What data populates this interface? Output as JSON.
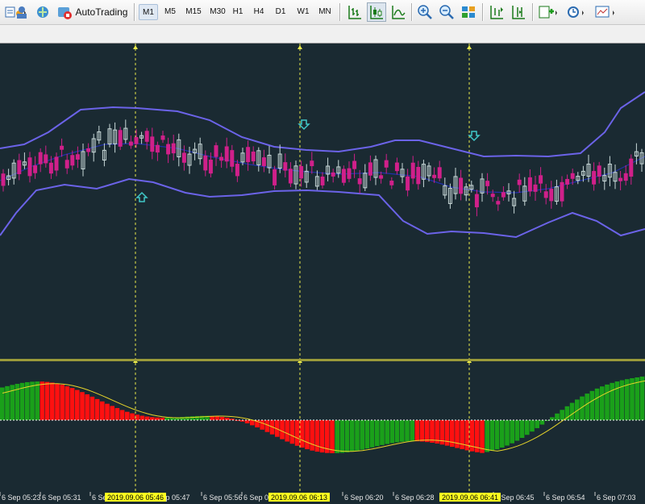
{
  "toolbar": {
    "autotrading_label": "AutoTrading",
    "timeframes": [
      "M1",
      "M5",
      "M15",
      "M30",
      "H1",
      "H4",
      "D1",
      "W1",
      "MN"
    ],
    "active_timeframe": "M1",
    "icons": [
      "new-order-icon",
      "navigator-icon",
      "market-watch-icon",
      "autotrading-icon",
      "bar-chart-icon",
      "candlestick-chart-icon",
      "line-chart-icon",
      "zoom-in-icon",
      "zoom-out-icon",
      "tile-windows-icon",
      "chart-shift-icon",
      "autoscroll-icon",
      "indicators-icon",
      "periods-icon",
      "templates-icon"
    ]
  },
  "chart": {
    "colors": {
      "background": "#1a2a32",
      "bull_candle": "#c8d8d8",
      "bear_candle": "#d0208a",
      "bands": "#6b63e8",
      "middle_band": "#2030a8",
      "vertical_lines": "#e8e84a",
      "separator": "#9a9a3a",
      "osc_positive": "#1aa01a",
      "osc_negative": "#ff1010",
      "signal_line": "#e6d42a",
      "zero_line": "#ffffff",
      "arrow": "#40c8c8",
      "vline_label_bg": "#ffff20"
    },
    "time_labels": [
      "6 Sep 05:23",
      "6 Sep 05:31",
      "6 Sep",
      "6 Sep 05:47",
      "6 Sep 05:56",
      "6 Sep 0",
      "6 Sep 06:20",
      "6 Sep 06:28",
      "6 Sep 06:45",
      "6 Sep 06:54",
      "6 Sep 07:03"
    ],
    "vline_labels": [
      "2019.09.06 05:46",
      "2019.09.06 06:13",
      "2019.09.06 06:41"
    ]
  }
}
